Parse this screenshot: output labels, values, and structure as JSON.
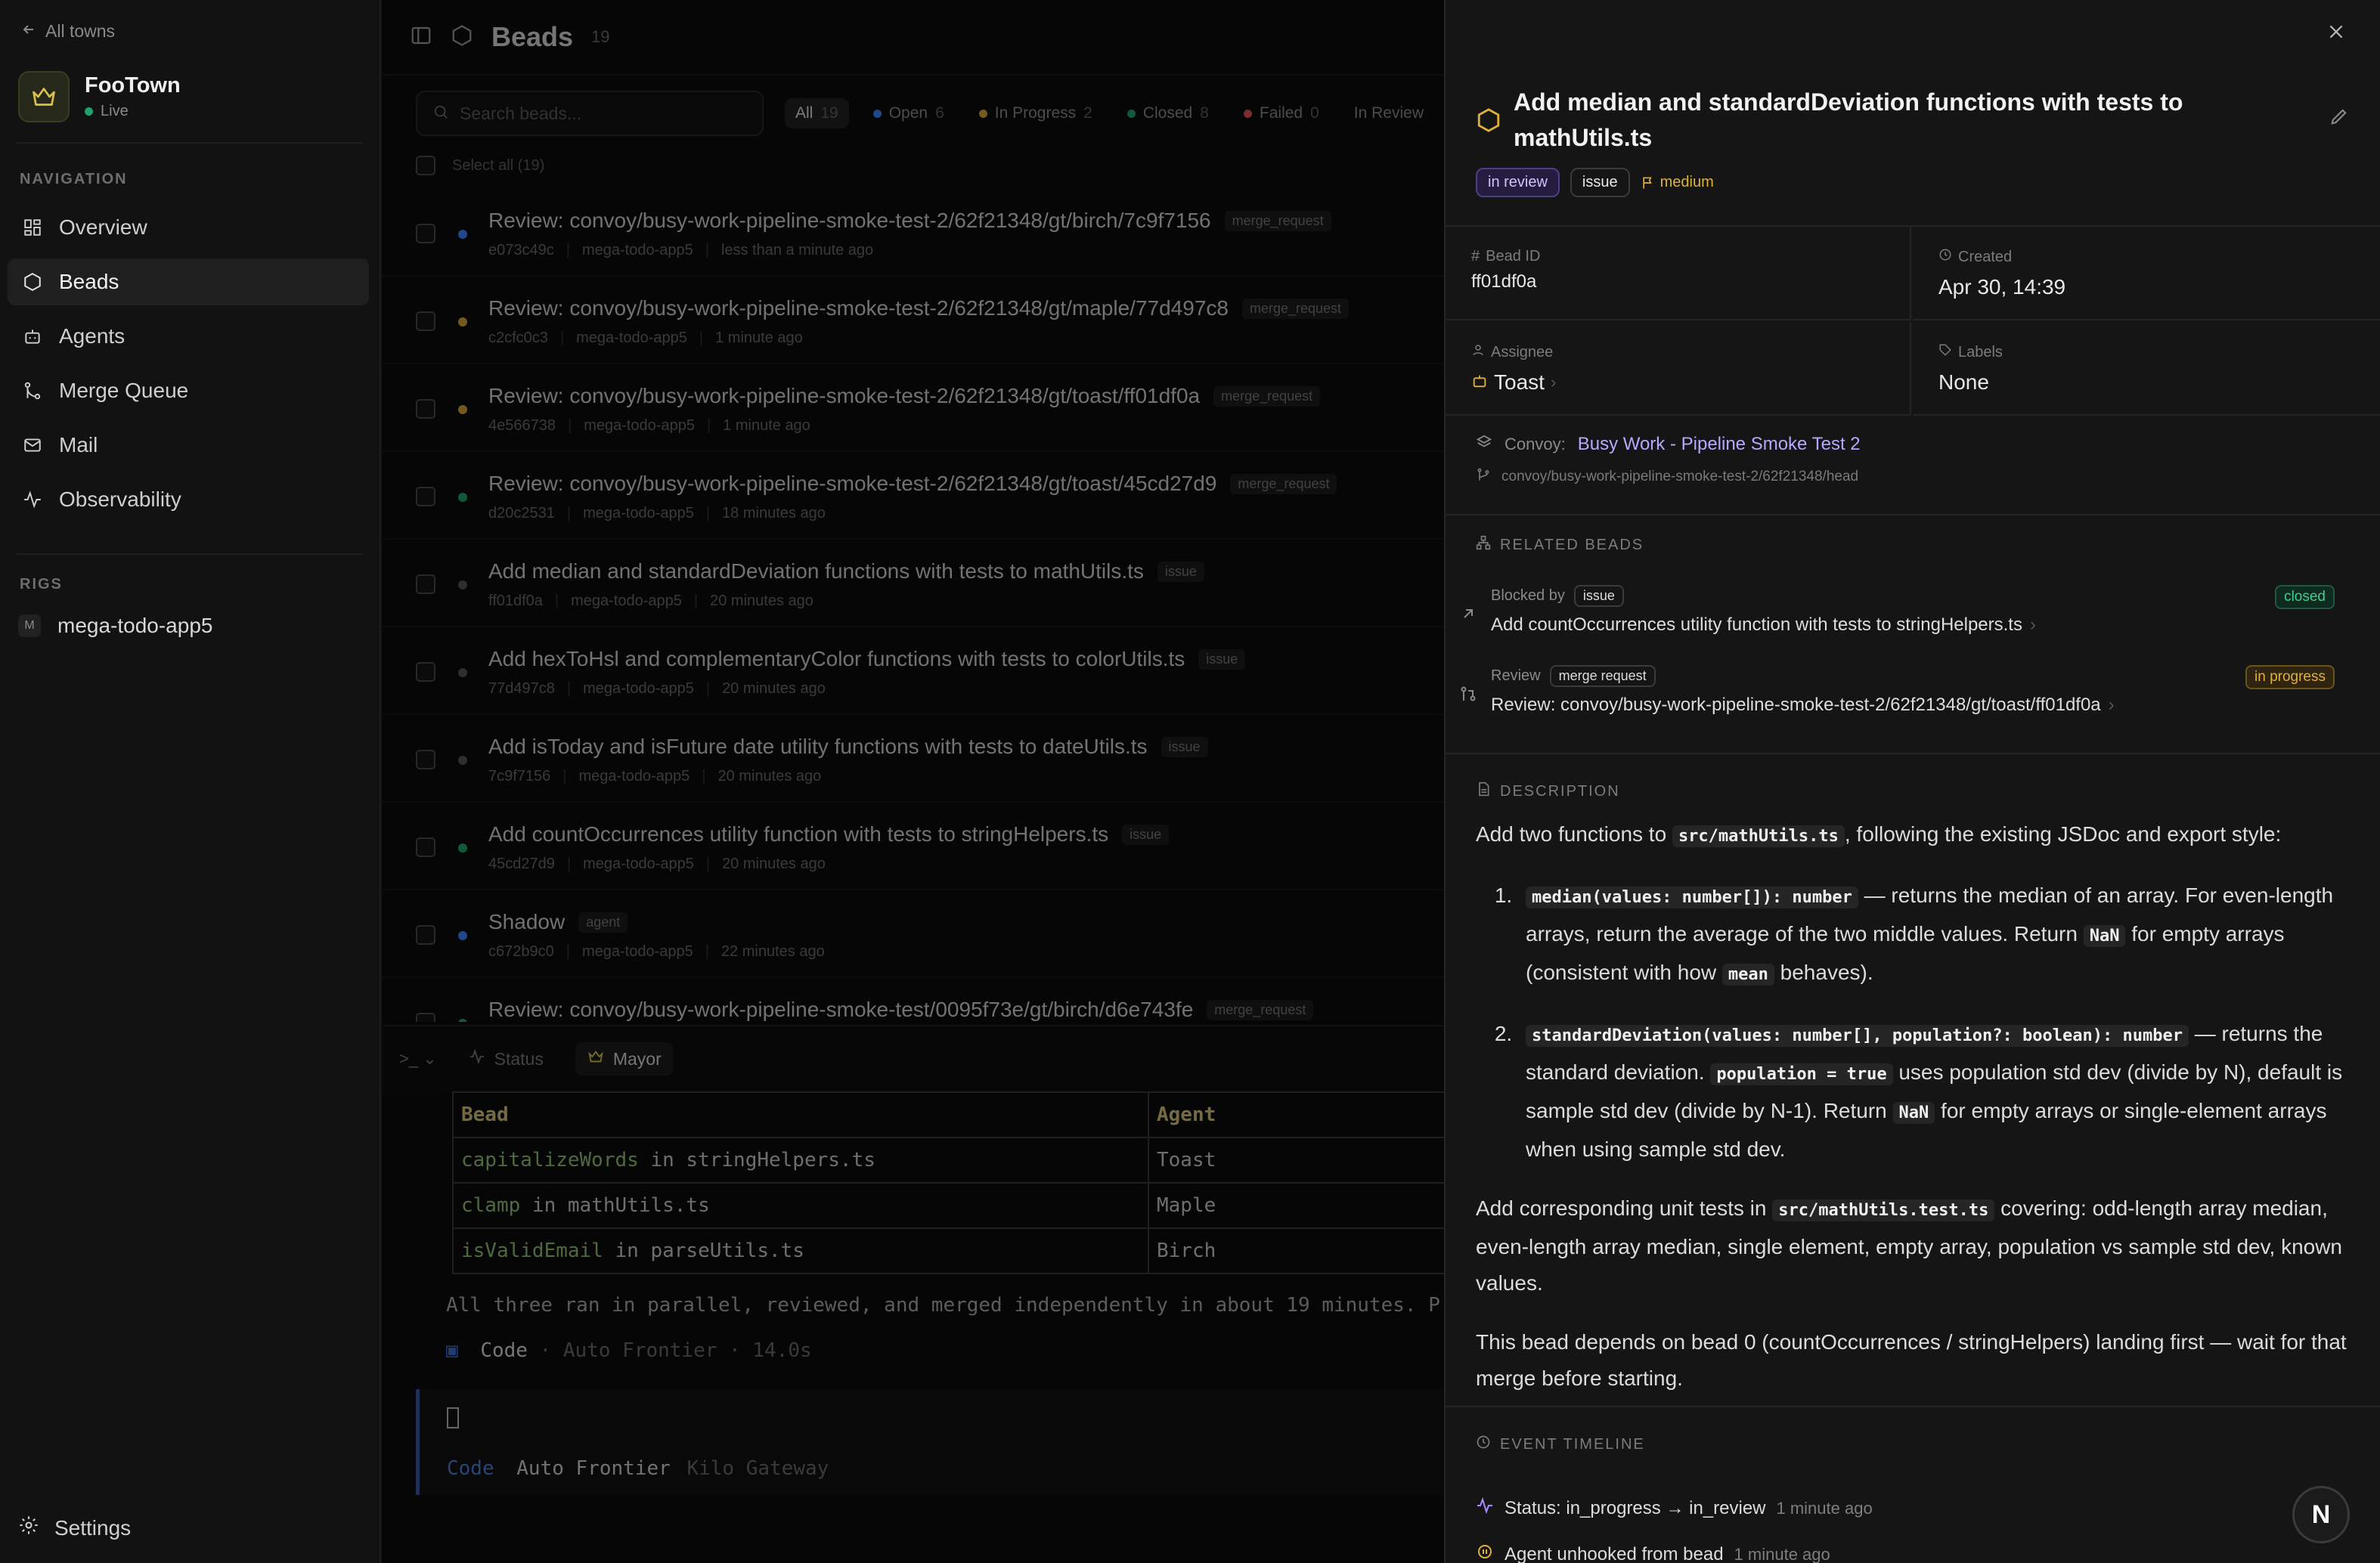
{
  "sidebar": {
    "back_label": "All towns",
    "town_name": "FooTown",
    "town_status": "Live",
    "nav_section": "NAVIGATION",
    "nav_items": [
      {
        "label": "Overview",
        "icon": "grid-icon"
      },
      {
        "label": "Beads",
        "icon": "hexagon-icon"
      },
      {
        "label": "Agents",
        "icon": "bot-icon"
      },
      {
        "label": "Merge Queue",
        "icon": "git-merge-icon"
      },
      {
        "label": "Mail",
        "icon": "mail-icon"
      },
      {
        "label": "Observability",
        "icon": "activity-icon"
      }
    ],
    "rigs_section": "RIGS",
    "rig_badge": "M",
    "rig_name": "mega-todo-app5",
    "settings_label": "Settings"
  },
  "main": {
    "title": "Beads",
    "count": "19",
    "search_placeholder": "Search beads...",
    "filters": [
      {
        "label": "All",
        "count": "19",
        "color": ""
      },
      {
        "label": "Open",
        "count": "6",
        "color": "#3b82f6"
      },
      {
        "label": "In Progress",
        "count": "2",
        "color": "#d6a23a"
      },
      {
        "label": "Closed",
        "count": "8",
        "color": "#22a06b"
      },
      {
        "label": "Failed",
        "count": "0",
        "color": "#e05252"
      },
      {
        "label": "In Review",
        "count": "",
        "color": ""
      }
    ],
    "select_all": "Select all (19)",
    "rows": [
      {
        "title": "Review: convoy/busy-work-pipeline-smoke-test-2/62f21348/gt/birch/7c9f7156",
        "tag": "merge_request",
        "id": "e073c49c",
        "rig": "mega-todo-app5",
        "time": "less than a minute ago",
        "dot": "#3b82f6"
      },
      {
        "title": "Review: convoy/busy-work-pipeline-smoke-test-2/62f21348/gt/maple/77d497c8",
        "tag": "merge_request",
        "id": "c2cfc0c3",
        "rig": "mega-todo-app5",
        "time": "1 minute ago",
        "dot": "#d6a23a"
      },
      {
        "title": "Review: convoy/busy-work-pipeline-smoke-test-2/62f21348/gt/toast/ff01df0a",
        "tag": "merge_request",
        "id": "4e566738",
        "rig": "mega-todo-app5",
        "time": "1 minute ago",
        "dot": "#d6a23a"
      },
      {
        "title": "Review: convoy/busy-work-pipeline-smoke-test-2/62f21348/gt/toast/45cd27d9",
        "tag": "merge_request",
        "id": "d20c2531",
        "rig": "mega-todo-app5",
        "time": "18 minutes ago",
        "dot": "#22a06b"
      },
      {
        "title": "Add median and standardDeviation functions with tests to mathUtils.ts",
        "tag": "issue",
        "id": "ff01df0a",
        "rig": "mega-todo-app5",
        "time": "20 minutes ago",
        "dot": "#555555"
      },
      {
        "title": "Add hexToHsl and complementaryColor functions with tests to colorUtils.ts",
        "tag": "issue",
        "id": "77d497c8",
        "rig": "mega-todo-app5",
        "time": "20 minutes ago",
        "dot": "#555555"
      },
      {
        "title": "Add isToday and isFuture date utility functions with tests to dateUtils.ts",
        "tag": "issue",
        "id": "7c9f7156",
        "rig": "mega-todo-app5",
        "time": "20 minutes ago",
        "dot": "#555555"
      },
      {
        "title": "Add countOccurrences utility function with tests to stringHelpers.ts",
        "tag": "issue",
        "id": "45cd27d9",
        "rig": "mega-todo-app5",
        "time": "20 minutes ago",
        "dot": "#22a06b"
      },
      {
        "title": "Shadow",
        "tag": "agent",
        "id": "c672b9c0",
        "rig": "mega-todo-app5",
        "time": "22 minutes ago",
        "dot": "#3b82f6"
      },
      {
        "title": "Review: convoy/busy-work-pipeline-smoke-test/0095f73e/gt/birch/d6e743fe",
        "tag": "merge_request",
        "id": "",
        "rig": "",
        "time": "",
        "dot": "#22a06b"
      }
    ]
  },
  "terminal": {
    "tabs": [
      {
        "label": "Status",
        "icon": "activity-icon"
      },
      {
        "label": "Mayor",
        "icon": "crown-icon"
      }
    ],
    "table_headers": [
      "Bead",
      "Agent"
    ],
    "table_rows": [
      {
        "fn": "capitalizeWords",
        "rest": " in stringHelpers.ts",
        "agent": "Toast"
      },
      {
        "fn": "clamp",
        "rest": " in mathUtils.ts",
        "agent": "Maple"
      },
      {
        "fn": "isValidEmail",
        "rest": " in parseUtils.ts",
        "agent": "Birch"
      }
    ],
    "summary": "All three ran in parallel, reviewed, and merged independently in about 19 minutes. P",
    "code_label": "Code",
    "code_meta": "· Auto Frontier · 14.0s",
    "input_code": "Code",
    "input_model": "Auto Frontier",
    "input_gateway": "Kilo Gateway"
  },
  "panel": {
    "title": "Add median and standardDeviation functions with tests to mathUtils.ts",
    "badge_status": "in review",
    "badge_type": "issue",
    "badge_priority": "medium",
    "bead_id_label": "Bead ID",
    "bead_id": "ff01df0a",
    "created_label": "Created",
    "created": "Apr 30, 14:39",
    "assignee_label": "Assignee",
    "assignee": "Toast",
    "labels_label": "Labels",
    "labels": "None",
    "convoy_label": "Convoy:",
    "convoy_name": "Busy Work - Pipeline Smoke Test 2",
    "convoy_ref": "convoy/busy-work-pipeline-smoke-test-2/62f21348/head",
    "related_title": "RELATED BEADS",
    "related": [
      {
        "kind": "Blocked by",
        "type": "issue",
        "title": "Add countOccurrences utility function with tests to stringHelpers.ts",
        "status": "closed"
      },
      {
        "kind": "Review",
        "type": "merge request",
        "title": "Review: convoy/busy-work-pipeline-smoke-test-2/62f21348/gt/toast/ff01df0a",
        "status": "in progress"
      }
    ],
    "description_title": "DESCRIPTION",
    "desc": {
      "p1_a": "Add two functions to ",
      "p1_code": "src/mathUtils.ts",
      "p1_b": ", following the existing JSDoc and export style:",
      "li1_code": "median(values: number[]): number",
      "li1_a": " — returns the median of an array. For even-length arrays, return the average of the two middle values. Return ",
      "li1_nan": "NaN",
      "li1_b": " for empty arrays (consistent with how ",
      "li1_mean": "mean",
      "li1_c": " behaves).",
      "li2_code": "standardDeviation(values: number[], population?: boolean): number",
      "li2_a": " — returns the standard deviation. ",
      "li2_pop": "population = true",
      "li2_b": " uses population std dev (divide by N), default is sample std dev (divide by N-1). Return ",
      "li2_nan": "NaN",
      "li2_c": " for empty arrays or single-element arrays when using sample std dev.",
      "p2_a": "Add corresponding unit tests in ",
      "p2_code": "src/mathUtils.test.ts",
      "p2_b": " covering: odd-length array median, even-length array median, single element, empty array, population vs sample std dev, known values.",
      "p3": "This bead depends on bead 0 (countOccurrences / stringHelpers) landing first — wait for that merge before starting."
    },
    "timeline_title": "EVENT TIMELINE",
    "timeline": [
      {
        "text": "Status: in_progress → in_review",
        "when": "1 minute ago",
        "icon": "activity-icon"
      },
      {
        "text": "Agent unhooked from bead",
        "when": "1 minute ago",
        "icon": "unhook-icon"
      }
    ],
    "fab_label": "N"
  },
  "colors": {
    "accent": "#b9a7ff",
    "open": "#3b82f6",
    "progress": "#d6a23a",
    "closed": "#22a06b",
    "failed": "#e05252"
  }
}
